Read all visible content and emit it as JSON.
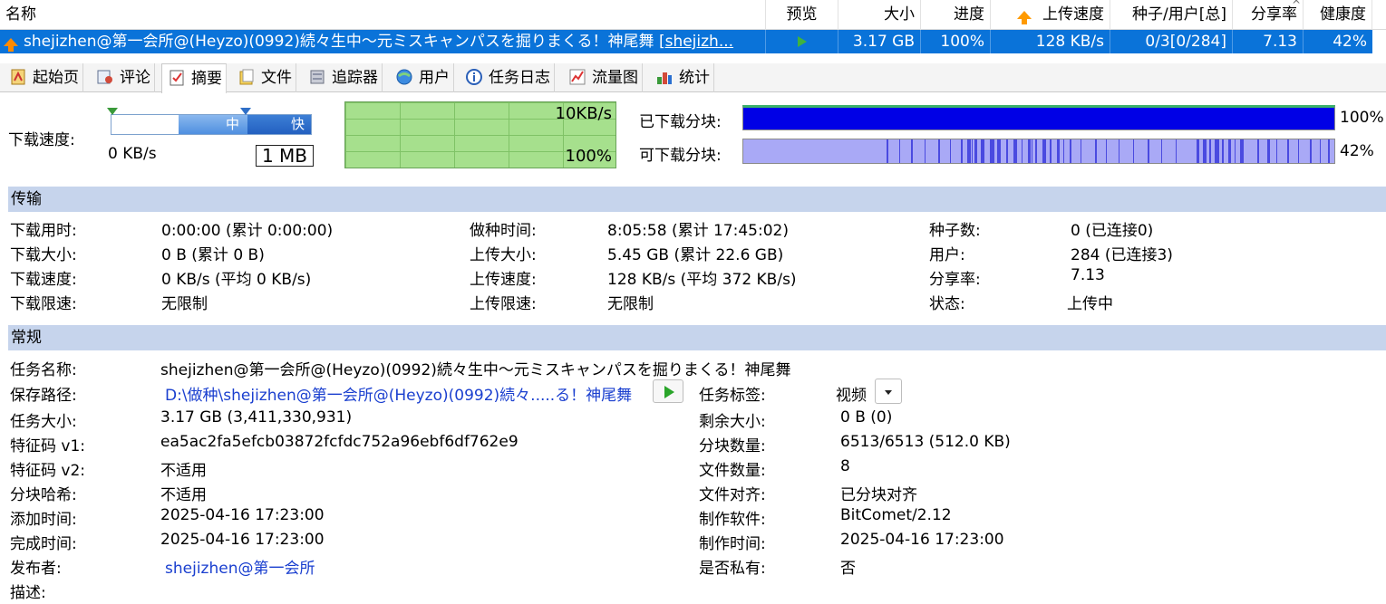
{
  "list_header": {
    "name": "名称",
    "preview": "预览",
    "size": "大小",
    "progress": "进度",
    "upload_speed": "上传速度",
    "seeds_peers": "种子/用户[总]",
    "share_ratio": "分享率",
    "health": "健康度"
  },
  "task": {
    "name": "shejizhen@第一会所@(Heyzo)(0992)続々生中～元ミスキャンパスを掘りまくる！神尾舞",
    "name_link": "[shejizh...",
    "size": "3.17 GB",
    "progress": "100%",
    "upload_speed": "128 KB/s",
    "seeds_peers": "0/3[0/284]",
    "share_ratio": "7.13",
    "health": "42%"
  },
  "tabs": [
    {
      "label": "起始页",
      "icon": "home-icon"
    },
    {
      "label": "评论",
      "icon": "comment-icon"
    },
    {
      "label": "摘要",
      "icon": "summary-icon"
    },
    {
      "label": "文件",
      "icon": "files-icon"
    },
    {
      "label": "追踪器",
      "icon": "tracker-icon"
    },
    {
      "label": "用户",
      "icon": "peers-icon"
    },
    {
      "label": "任务日志",
      "icon": "log-icon"
    },
    {
      "label": "流量图",
      "icon": "traffic-chart-icon"
    },
    {
      "label": "统计",
      "icon": "statistics-icon"
    }
  ],
  "speed": {
    "label": "下载速度:",
    "slider_mid": "中",
    "slider_fast": "快",
    "current": "0 KB/s",
    "limit": "1 MB"
  },
  "graph": {
    "top_label": "10KB/s",
    "bottom_label": "100%"
  },
  "pieces": {
    "downloaded_label": "已下载分块:",
    "downloaded_pct": "100%",
    "available_label": "可下载分块:",
    "available_pct": "42%"
  },
  "transfer": {
    "title": "传输",
    "rows": [
      [
        "下载用时:",
        "0:00:00 (累计 0:00:00)",
        "做种时间:",
        "8:05:58 (累计 17:45:02)",
        "种子数:",
        "0 (已连接0)"
      ],
      [
        "下载大小:",
        "0 B (累计 0 B)",
        "上传大小:",
        "5.45 GB (累计 22.6 GB)",
        "用户:",
        "284 (已连接3)"
      ],
      [
        "下载速度:",
        "0 KB/s (平均 0 KB/s)",
        "上传速度:",
        "128 KB/s (平均 372 KB/s)",
        "分享率:",
        "7.13"
      ],
      [
        "下载限速:",
        "无限制",
        "上传限速:",
        "无限制",
        "状态:",
        "上传中"
      ]
    ]
  },
  "general": {
    "title": "常规",
    "task_name_label": "任务名称:",
    "task_name": "shejizhen@第一会所@(Heyzo)(0992)続々生中～元ミスキャンパスを掘りまくる！神尾舞",
    "save_path_label": "保存路径:",
    "save_path": "D:\\做种\\shejizhen@第一会所@(Heyzo)(0992)続々.....る！神尾舞",
    "tag_label": "任务标签:",
    "tag_value": "视频",
    "left": [
      [
        "任务大小:",
        "3.17 GB (3,411,330,931)"
      ],
      [
        "特征码 v1:",
        "ea5ac2fa5efcb03872fcfdc752a96ebf6df762e9"
      ],
      [
        "特征码 v2:",
        "不适用"
      ],
      [
        "分块哈希:",
        "不适用"
      ],
      [
        "添加时间:",
        "2025-04-16 17:23:00"
      ],
      [
        "完成时间:",
        "2025-04-16 17:23:00"
      ]
    ],
    "right": [
      [
        "剩余大小:",
        "0 B (0)"
      ],
      [
        "分块数量:",
        "6513/6513 (512.0 KB)"
      ],
      [
        "文件数量:",
        "8"
      ],
      [
        "文件对齐:",
        "已分块对齐"
      ],
      [
        "制作软件:",
        "BitComet/2.12"
      ],
      [
        "制作时间:",
        "2025-04-16 17:23:00"
      ],
      [
        "是否私有:",
        "否"
      ]
    ],
    "publisher_label": "发布者:",
    "publisher": "shejizhen@第一会所",
    "description_label": "描述:"
  },
  "colors": {
    "selected_row": "#0a73d9",
    "section_bar": "#c6d4ec",
    "piece_done": "#0000e6",
    "piece_available": "#a9a9f6",
    "graph_bg": "#a6e08d",
    "link": "#1a3fcf"
  }
}
